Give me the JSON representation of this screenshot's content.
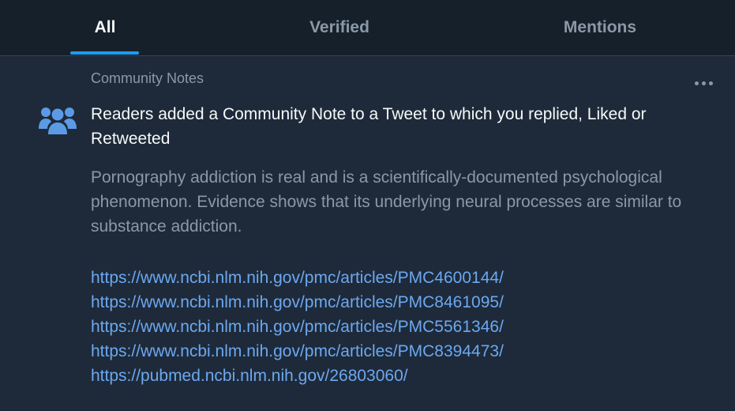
{
  "tabs": [
    {
      "label": "All",
      "active": true
    },
    {
      "label": "Verified",
      "active": false
    },
    {
      "label": "Mentions",
      "active": false
    }
  ],
  "notification": {
    "source": "Community Notes",
    "icon": "community-notes-people-icon",
    "more_icon": "more-options-icon",
    "heading": "Readers added a Community Note to a Tweet to which you replied, Liked or Retweeted",
    "note_text": "Pornography addiction is real and is a scientifically-documented psychological phenomenon. Evidence shows that its underlying neural processes are similar to substance addiction.",
    "links": [
      "https://www.ncbi.nlm.nih.gov/pmc/articles/PMC4600144/",
      "https://www.ncbi.nlm.nih.gov/pmc/articles/PMC8461095/",
      "https://www.ncbi.nlm.nih.gov/pmc/articles/PMC5561346/",
      "https://www.ncbi.nlm.nih.gov/pmc/articles/PMC8394473/",
      "https://pubmed.ncbi.nlm.nih.gov/26803060/"
    ]
  },
  "colors": {
    "background": "#15202b",
    "card": "#1e2a3a",
    "accent": "#1d9bf0",
    "link": "#6ca8f0",
    "icon": "#5b9be6"
  }
}
